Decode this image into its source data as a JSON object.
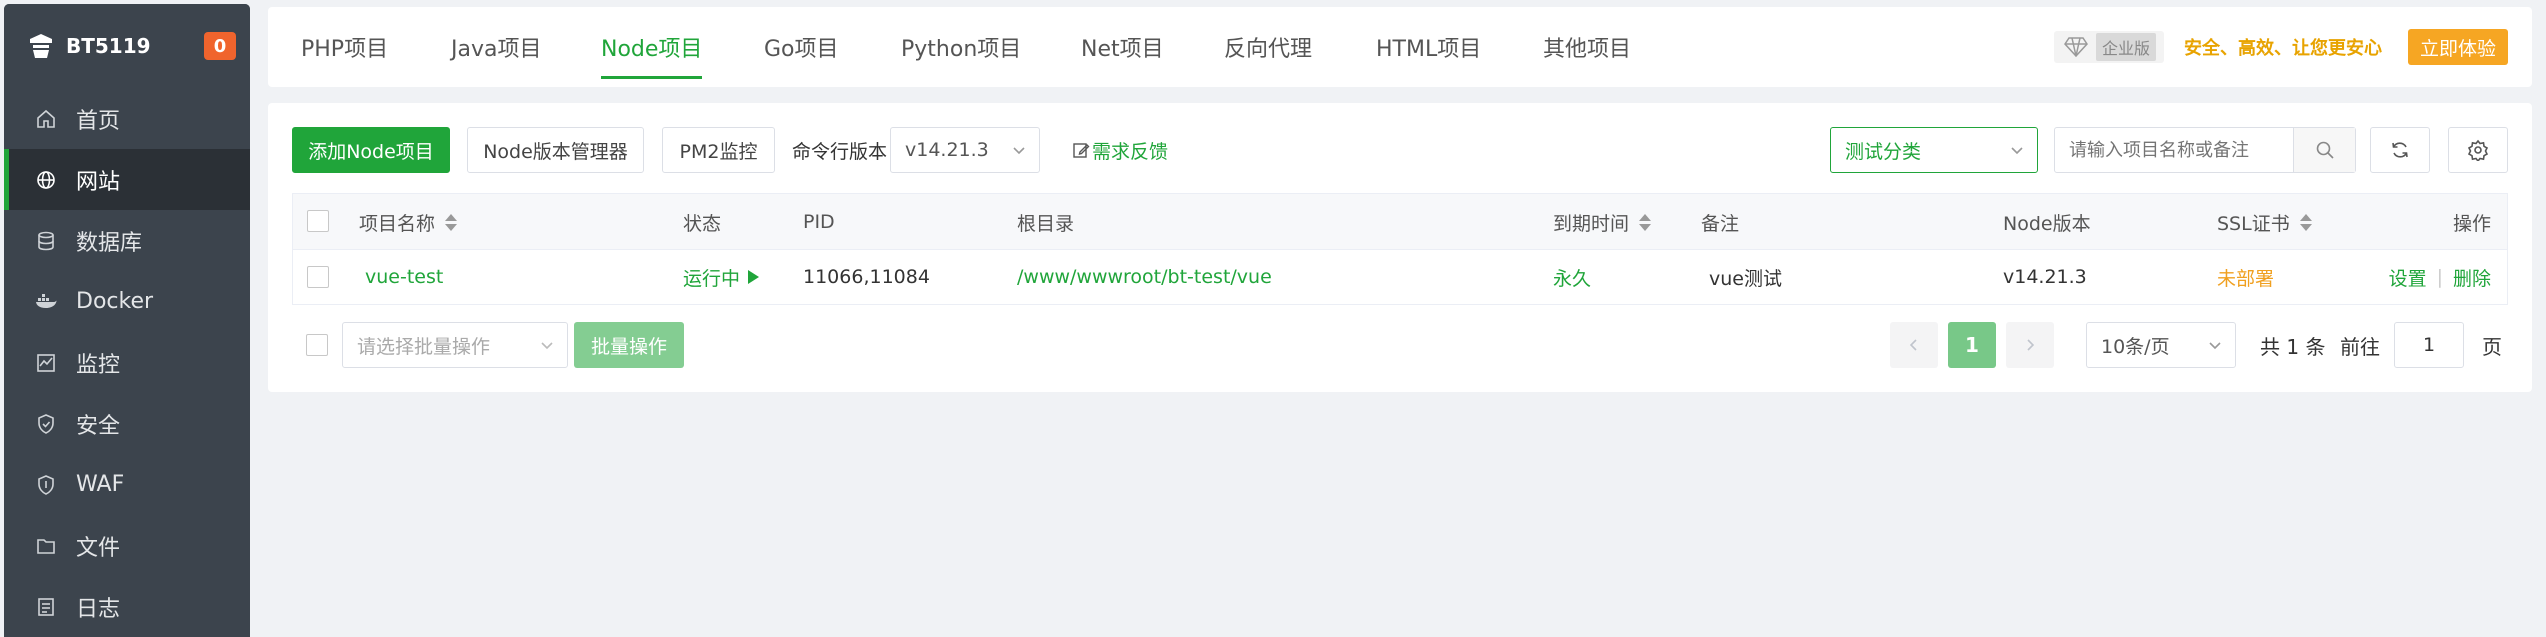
{
  "sidebar": {
    "brand_name": "BT5119",
    "badge_count": "0",
    "items": [
      {
        "label": "首页",
        "icon": "home-icon"
      },
      {
        "label": "网站",
        "icon": "globe-icon",
        "active": true
      },
      {
        "label": "数据库",
        "icon": "database-icon"
      },
      {
        "label": "Docker",
        "icon": "docker-icon"
      },
      {
        "label": "监控",
        "icon": "monitor-icon"
      },
      {
        "label": "安全",
        "icon": "shield-icon"
      },
      {
        "label": "WAF",
        "icon": "waf-icon"
      },
      {
        "label": "文件",
        "icon": "folder-icon"
      },
      {
        "label": "日志",
        "icon": "log-icon"
      }
    ]
  },
  "tabs": [
    {
      "label": "PHP项目"
    },
    {
      "label": "Java项目"
    },
    {
      "label": "Node项目",
      "active": true
    },
    {
      "label": "Go项目"
    },
    {
      "label": "Python项目"
    },
    {
      "label": "Net项目"
    },
    {
      "label": "反向代理"
    },
    {
      "label": "HTML项目"
    },
    {
      "label": "其他项目"
    }
  ],
  "promo": {
    "edition_tag": "企业版",
    "slogan": "安全、高效、让您更安心",
    "trial_label": "立即体验"
  },
  "toolbar": {
    "add_label": "添加Node项目",
    "version_manager_label": "Node版本管理器",
    "pm2_label": "PM2监控",
    "cli_version_label": "命令行版本",
    "cli_version_value": "v14.21.3",
    "feedback_label": "需求反馈",
    "category_value": "测试分类",
    "search_placeholder": "请输入项目名称或备注"
  },
  "table": {
    "headers": {
      "name": "项目名称",
      "status": "状态",
      "pid": "PID",
      "root": "根目录",
      "expire": "到期时间",
      "remark": "备注",
      "node_version": "Node版本",
      "ssl": "SSL证书",
      "actions": "操作"
    },
    "rows": [
      {
        "name": "vue-test",
        "status": "运行中",
        "pid": "11066,11084",
        "root": "/www/wwwroot/bt-test/vue",
        "expire": "永久",
        "remark": "vue测试",
        "node_version": "v14.21.3",
        "ssl": "未部署",
        "action_settings": "设置",
        "action_delete": "删除"
      }
    ]
  },
  "footer": {
    "batch_placeholder": "请选择批量操作",
    "batch_button": "批量操作",
    "current_page": "1",
    "page_size": "10条/页",
    "total_text": "共 1 条",
    "goto_label": "前往",
    "goto_value": "1",
    "page_suffix": "页"
  },
  "colors": {
    "accent": "#20a53a",
    "sidebar_bg": "#3c444d",
    "warning": "#f0a020"
  }
}
